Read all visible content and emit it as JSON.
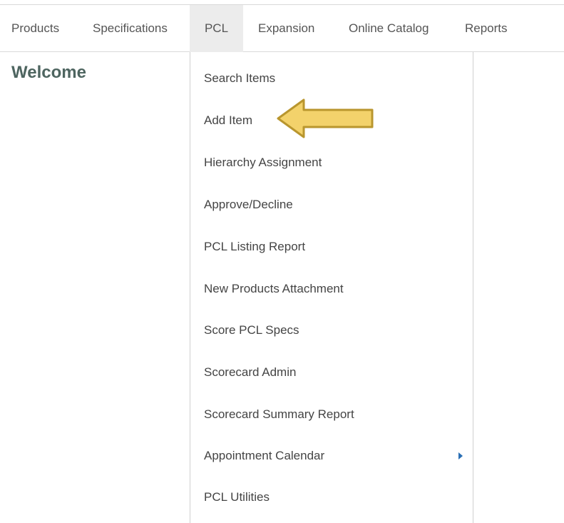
{
  "nav": {
    "items": [
      {
        "label": "Products"
      },
      {
        "label": "Specifications"
      },
      {
        "label": "PCL"
      },
      {
        "label": "Expansion"
      },
      {
        "label": "Online Catalog"
      },
      {
        "label": "Reports"
      }
    ],
    "active": "PCL"
  },
  "main": {
    "welcome": "Welcome"
  },
  "pcl_menu": {
    "items": [
      {
        "label": "Search Items"
      },
      {
        "label": "Add Item"
      },
      {
        "label": "Hierarchy Assignment"
      },
      {
        "label": "Approve/Decline"
      },
      {
        "label": "PCL Listing Report"
      },
      {
        "label": "New Products Attachment"
      },
      {
        "label": "Score PCL Specs"
      },
      {
        "label": "Scorecard Admin"
      },
      {
        "label": "Scorecard Summary Report"
      },
      {
        "label": "Appointment Calendar"
      },
      {
        "label": "PCL Utilities"
      }
    ]
  },
  "colors": {
    "welcome_text": "#4e6560",
    "active_tab_bg": "#ececec",
    "submenu_arrow": "#2a6fb5",
    "annotation_arrow_fill": "#f3d26b",
    "annotation_arrow_stroke": "#b9962e"
  },
  "icons": {
    "submenu": "caret-right-icon",
    "annotation": "arrow-left-icon"
  }
}
